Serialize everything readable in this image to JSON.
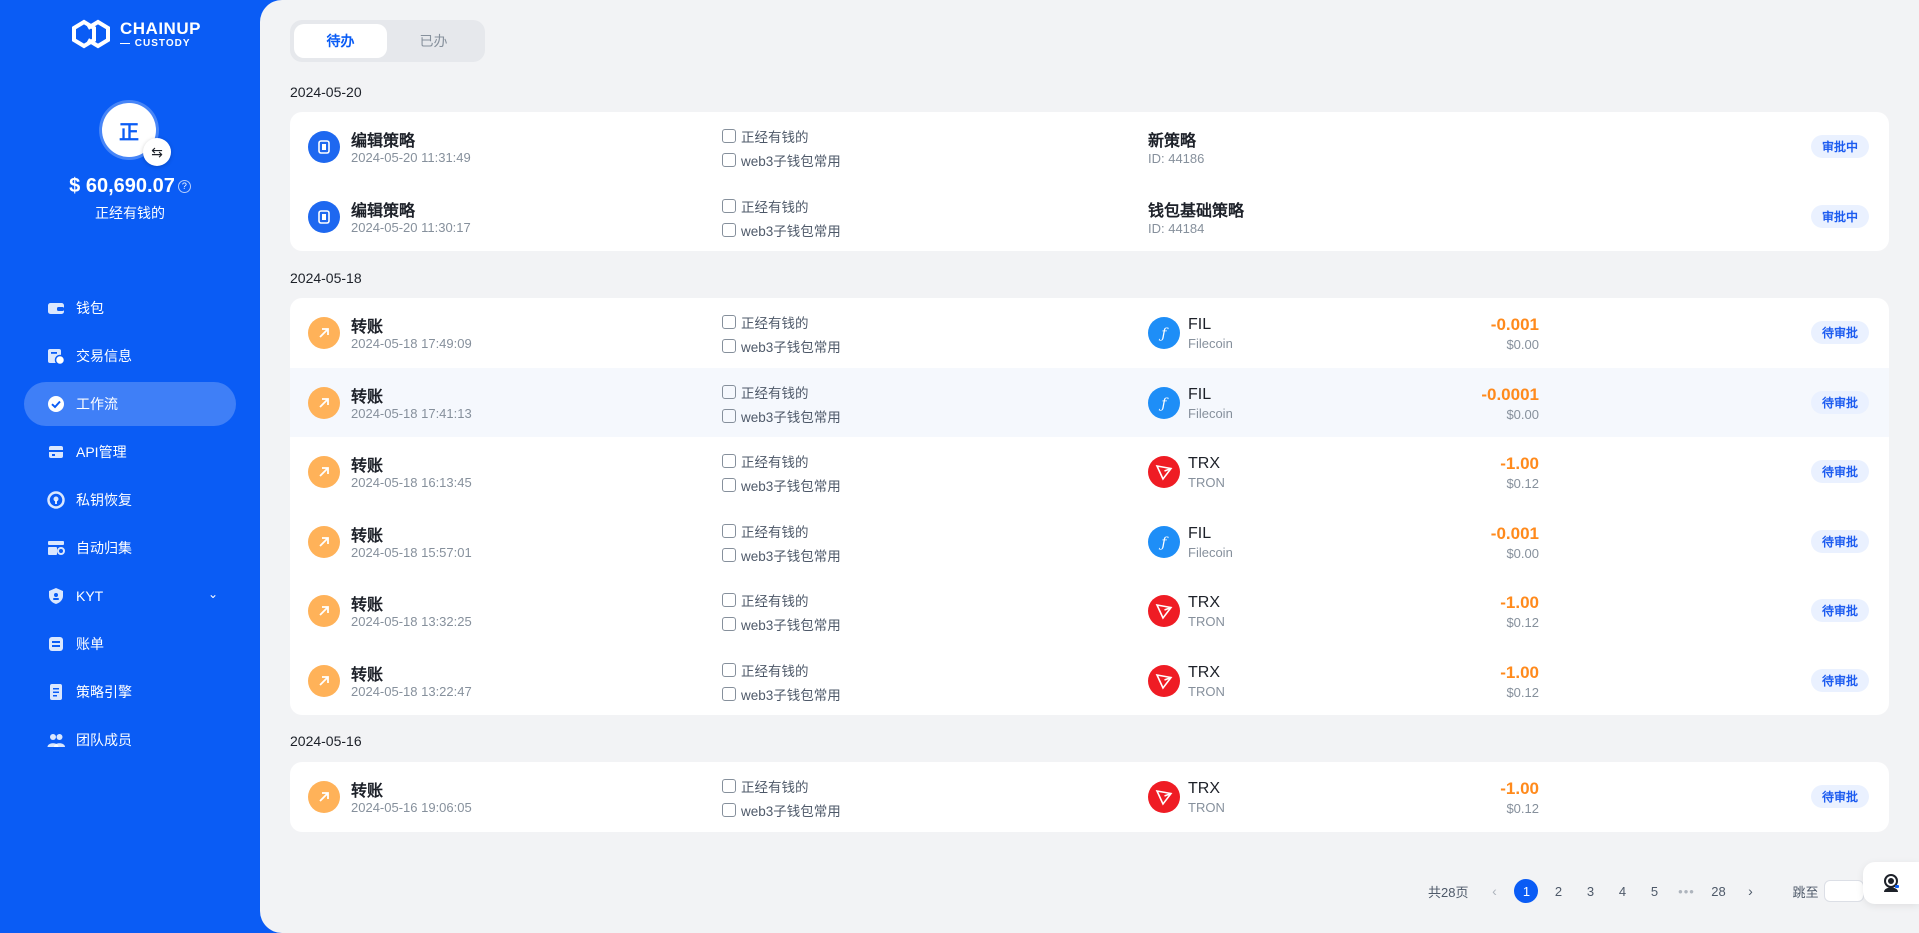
{
  "brand": {
    "line1": "CHAINUP",
    "line2": "— CUSTODY"
  },
  "profile": {
    "avatar_char": "正",
    "balance": "$ 60,690.07",
    "org_name": "正经有钱的"
  },
  "nav": {
    "items": [
      {
        "label": "钱包",
        "icon": "wallet-icon"
      },
      {
        "label": "交易信息",
        "icon": "transaction-icon"
      },
      {
        "label": "工作流",
        "icon": "workflow-icon",
        "active": true
      },
      {
        "label": "API管理",
        "icon": "api-icon"
      },
      {
        "label": "私钥恢复",
        "icon": "key-recovery-icon"
      },
      {
        "label": "自动归集",
        "icon": "auto-collect-icon"
      },
      {
        "label": "KYT",
        "icon": "shield-icon"
      },
      {
        "label": "账单",
        "icon": "bill-icon"
      },
      {
        "label": "策略引擎",
        "icon": "policy-icon"
      },
      {
        "label": "团队成员",
        "icon": "team-icon"
      }
    ]
  },
  "tabs": [
    {
      "label": "待办"
    },
    {
      "label": "已办"
    }
  ],
  "groups": [
    {
      "date": "2024-05-20",
      "rows": [
        {
          "type": "policy",
          "title": "编辑策略",
          "time": "2024-05-20 11:31:49",
          "org": "正经有钱的",
          "wallet": "web3子钱包常用",
          "policy_name": "新策略",
          "policy_id": "ID: 44186",
          "status": "审批中"
        },
        {
          "type": "policy",
          "title": "编辑策略",
          "time": "2024-05-20 11:30:17",
          "org": "正经有钱的",
          "wallet": "web3子钱包常用",
          "policy_name": "钱包基础策略",
          "policy_id": "ID: 44184",
          "status": "审批中"
        }
      ]
    },
    {
      "date": "2024-05-18",
      "rows": [
        {
          "type": "transfer",
          "title": "转账",
          "time": "2024-05-18 17:49:09",
          "org": "正经有钱的",
          "wallet": "web3子钱包常用",
          "coin": "fil",
          "symbol": "FIL",
          "chain": "Filecoin",
          "amount": "-0.001",
          "usd": "$0.00",
          "status": "待审批"
        },
        {
          "type": "transfer",
          "title": "转账",
          "time": "2024-05-18 17:41:13",
          "org": "正经有钱的",
          "wallet": "web3子钱包常用",
          "coin": "fil",
          "symbol": "FIL",
          "chain": "Filecoin",
          "amount": "-0.0001",
          "usd": "$0.00",
          "status": "待审批"
        },
        {
          "type": "transfer",
          "title": "转账",
          "time": "2024-05-18 16:13:45",
          "org": "正经有钱的",
          "wallet": "web3子钱包常用",
          "coin": "trx",
          "symbol": "TRX",
          "chain": "TRON",
          "amount": "-1.00",
          "usd": "$0.12",
          "status": "待审批"
        },
        {
          "type": "transfer",
          "title": "转账",
          "time": "2024-05-18 15:57:01",
          "org": "正经有钱的",
          "wallet": "web3子钱包常用",
          "coin": "fil",
          "symbol": "FIL",
          "chain": "Filecoin",
          "amount": "-0.001",
          "usd": "$0.00",
          "status": "待审批"
        },
        {
          "type": "transfer",
          "title": "转账",
          "time": "2024-05-18 13:32:25",
          "org": "正经有钱的",
          "wallet": "web3子钱包常用",
          "coin": "trx",
          "symbol": "TRX",
          "chain": "TRON",
          "amount": "-1.00",
          "usd": "$0.12",
          "status": "待审批"
        },
        {
          "type": "transfer",
          "title": "转账",
          "time": "2024-05-18 13:22:47",
          "org": "正经有钱的",
          "wallet": "web3子钱包常用",
          "coin": "trx",
          "symbol": "TRX",
          "chain": "TRON",
          "amount": "-1.00",
          "usd": "$0.12",
          "status": "待审批"
        }
      ]
    },
    {
      "date": "2024-05-16",
      "rows": [
        {
          "type": "transfer",
          "title": "转账",
          "time": "2024-05-16 19:06:05",
          "org": "正经有钱的",
          "wallet": "web3子钱包常用",
          "coin": "trx",
          "symbol": "TRX",
          "chain": "TRON",
          "amount": "-1.00",
          "usd": "$0.12",
          "status": "待审批"
        }
      ]
    }
  ],
  "pagination": {
    "total_label": "共28页",
    "pages": [
      "1",
      "2",
      "3",
      "4",
      "5",
      "•••",
      "28"
    ],
    "jump_label": "跳至",
    "page_suffix": "页"
  },
  "colors": {
    "brand_blue": "#0a5cf5",
    "amount_orange": "#ff8a1c",
    "fil_blue": "#1e8ef7",
    "trx_red": "#ef1c24"
  }
}
